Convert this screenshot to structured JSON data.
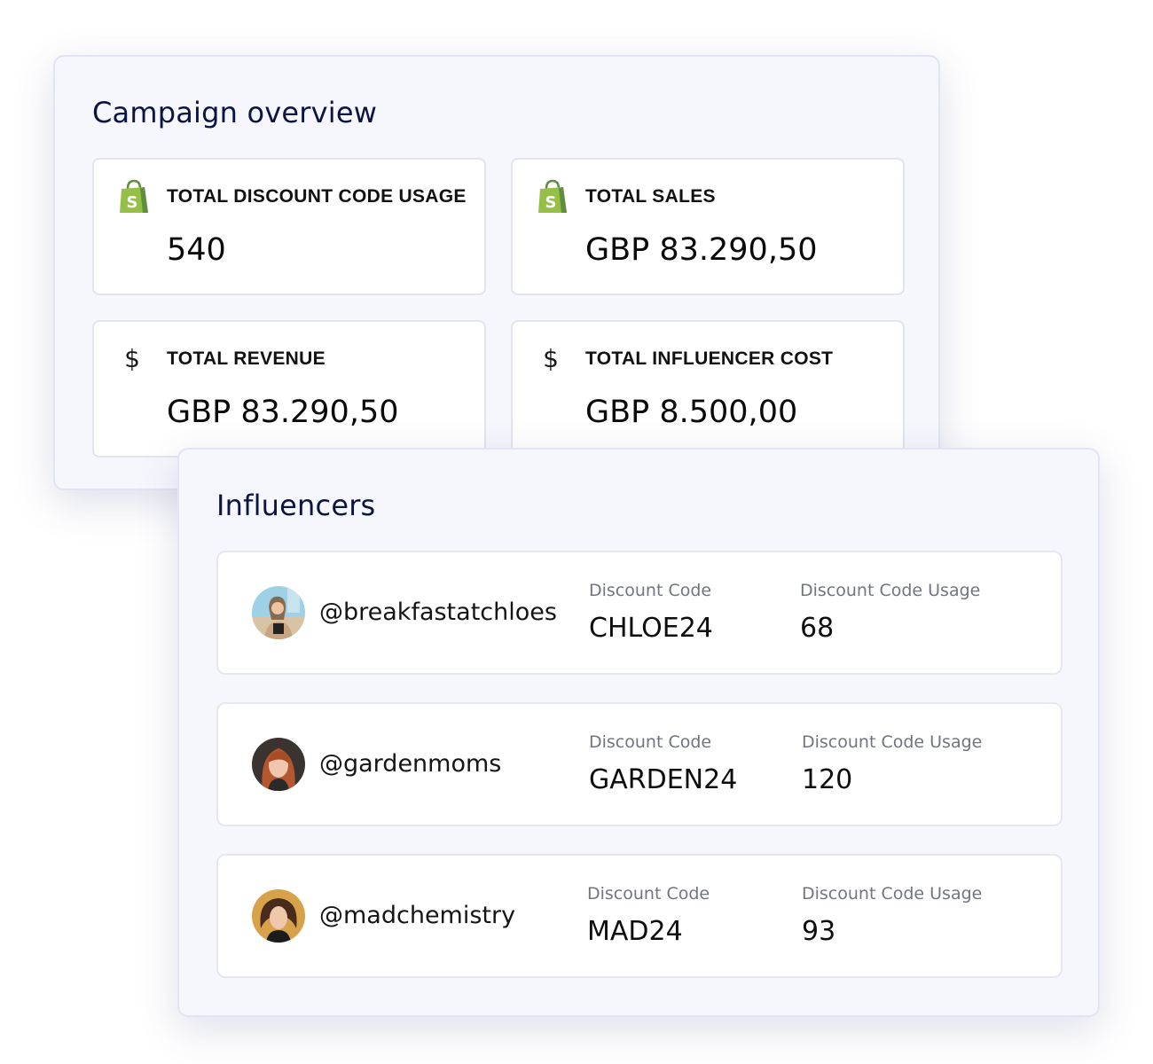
{
  "campaign_overview": {
    "title": "Campaign overview",
    "stats": [
      {
        "icon": "shopify-bag-icon",
        "label": "TOTAL DISCOUNT CODE USAGE",
        "value": "540"
      },
      {
        "icon": "shopify-bag-icon",
        "label": "TOTAL SALES",
        "value": "GBP 83.290,50"
      },
      {
        "icon": "dollar-icon",
        "label": "TOTAL REVENUE",
        "value": "GBP 83.290,50",
        "symbol": "$"
      },
      {
        "icon": "dollar-icon",
        "label": "TOTAL INFLUENCER COST",
        "value": "GBP 8.500,00",
        "symbol": "$"
      }
    ]
  },
  "influencers": {
    "title": "Influencers",
    "rows": [
      {
        "handle": "@breakfastatchloes",
        "code_label": "Discount Code",
        "code": "CHLOE24",
        "usage_label": "Discount Code Usage",
        "usage": "68"
      },
      {
        "handle": "@gardenmoms",
        "code_label": "Discount Code",
        "code": "GARDEN24",
        "usage_label": "Discount Code Usage",
        "usage": "120"
      },
      {
        "handle": "@madchemistry",
        "code_label": "Discount Code",
        "code": "MAD24",
        "usage_label": "Discount Code Usage",
        "usage": "93"
      }
    ]
  },
  "colors": {
    "shopify_green": "#95bf47",
    "shopify_dark_green": "#5e8e3e",
    "title_navy": "#0c1442",
    "panel_bg": "#f6f7fd"
  }
}
